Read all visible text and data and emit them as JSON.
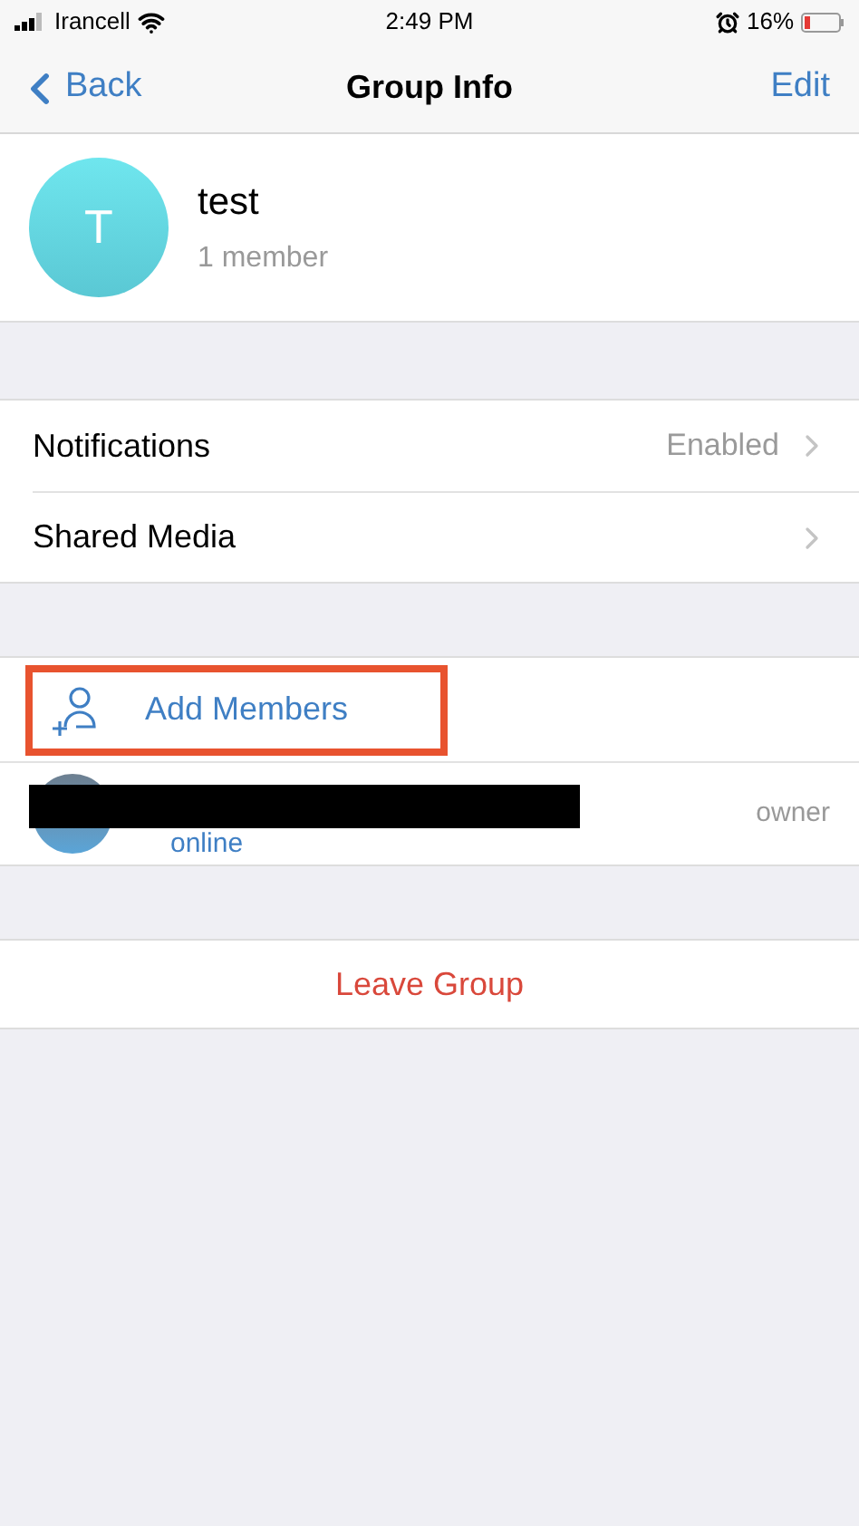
{
  "status_bar": {
    "carrier": "Irancell",
    "time": "2:49 PM",
    "battery": "16%"
  },
  "nav": {
    "back": "Back",
    "title": "Group Info",
    "action": "Edit"
  },
  "group": {
    "avatar_letter": "T",
    "name": "test",
    "subtitle": "1 member"
  },
  "settings": [
    {
      "label": "Notifications",
      "value": "Enabled"
    },
    {
      "label": "Shared Media"
    }
  ],
  "add_members": {
    "label": "Add Members",
    "highlighted": true
  },
  "members": [
    {
      "status": "online",
      "role": "owner",
      "redacted": true
    }
  ],
  "leave": "Leave Group"
}
